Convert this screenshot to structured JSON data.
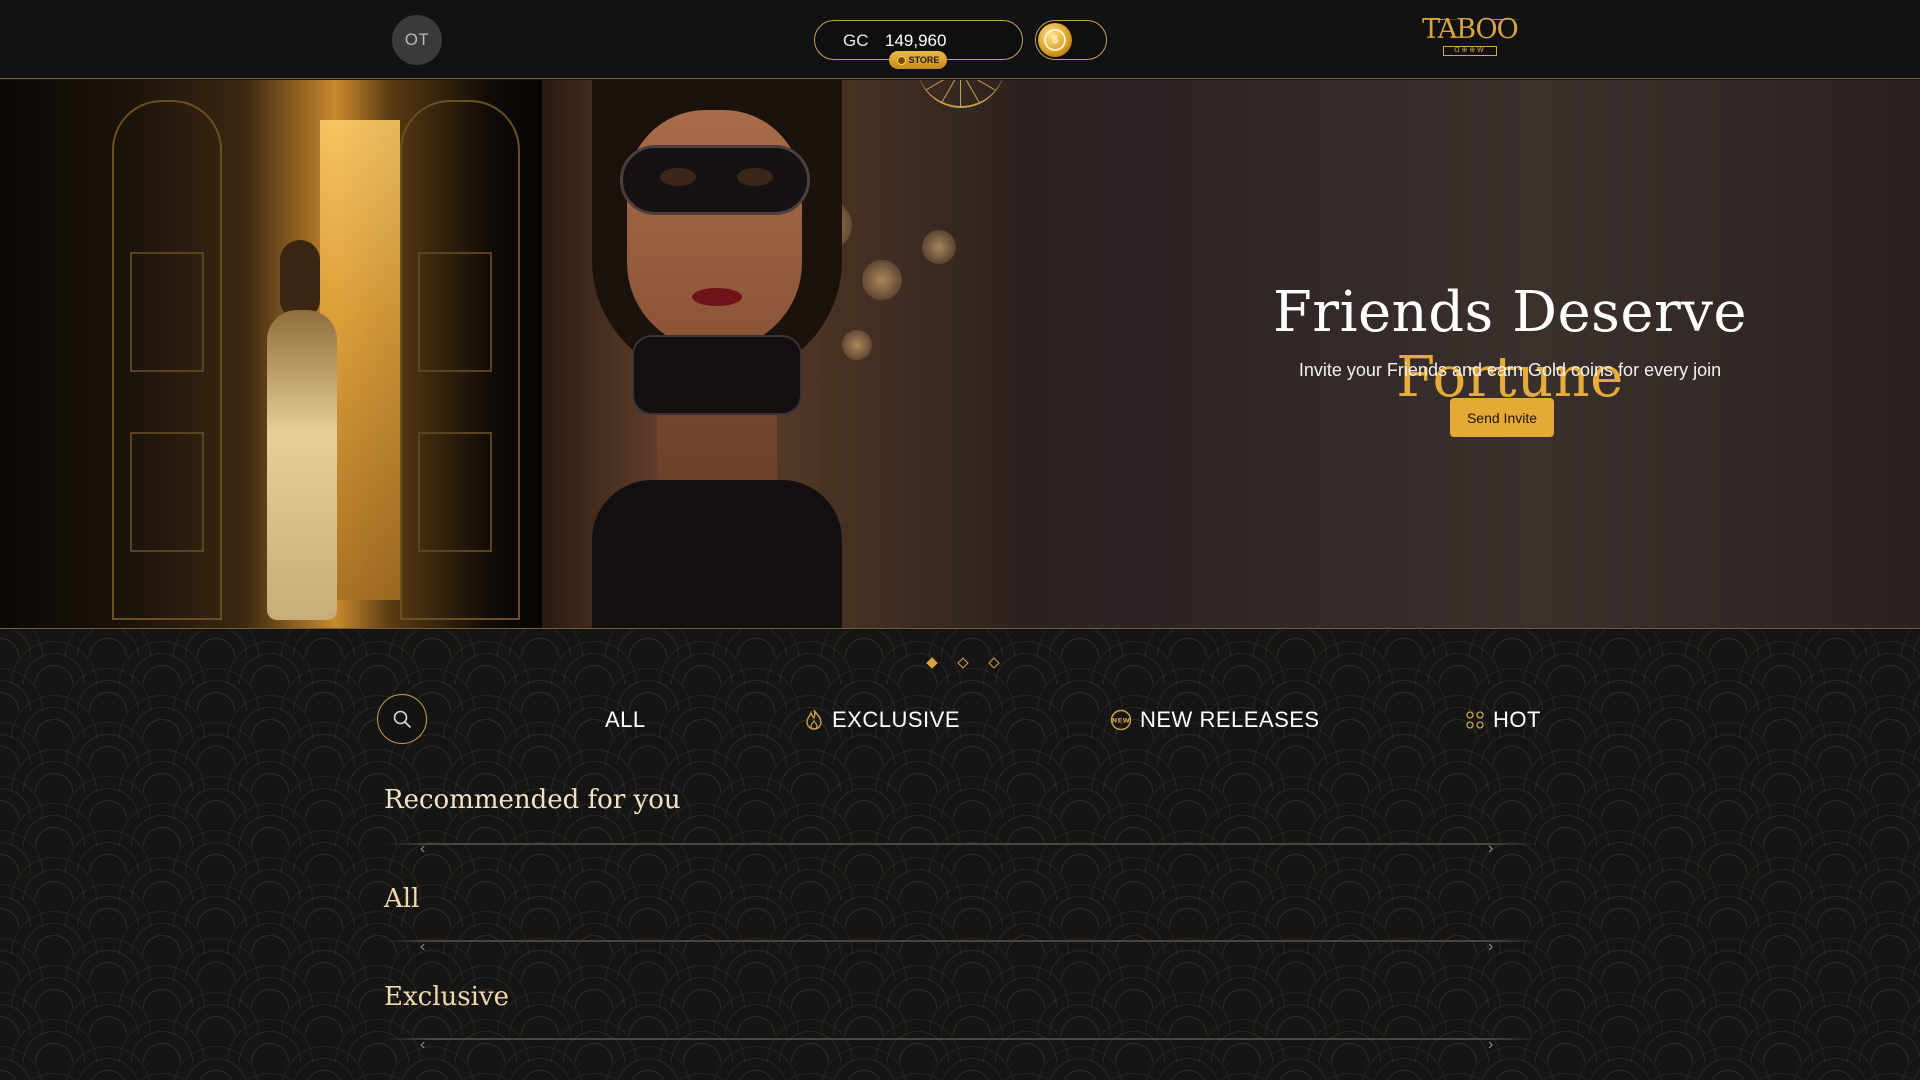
{
  "header": {
    "avatar_initials": "OT",
    "balance_currency": "GC",
    "balance_amount": "149,960",
    "store_label": "STORE",
    "logo_name": "TABOO",
    "logo_sub": "ᗡ⊕⊕Ꮃ"
  },
  "hero": {
    "title_white": "Friends Deserve",
    "title_gold": "Fortune",
    "subtitle": "Invite your Friends and earn Gold coins for every join",
    "button_label": "Send Invite",
    "slides": 3,
    "active_slide": 0
  },
  "tabs": [
    {
      "label": "ALL",
      "icon": "none"
    },
    {
      "label": "EXCLUSIVE",
      "icon": "flame-icon"
    },
    {
      "label": "NEW RELEASES",
      "icon": "new-badge-icon"
    },
    {
      "label": "HOT",
      "icon": "cards-icon"
    }
  ],
  "sections": [
    {
      "title": "Recommended for you"
    },
    {
      "title": "All"
    },
    {
      "title": "Exclusive"
    }
  ],
  "colors": {
    "accent_gold": "#e5a935",
    "border_gold": "#c9a24a",
    "background": "#161516",
    "header_bg": "#121214"
  }
}
